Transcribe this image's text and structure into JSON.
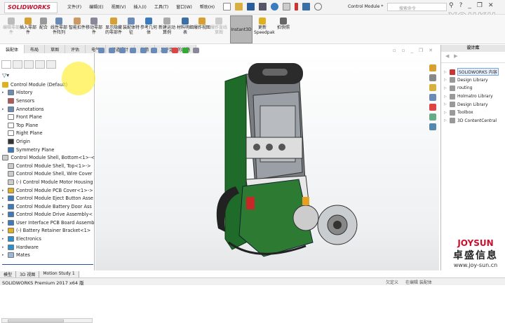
{
  "title": {
    "logo": "SOLIDWORKS",
    "menus": [
      "文件(F)",
      "编辑(E)",
      "视图(V)",
      "插入(I)",
      "工具(T)",
      "窗口(W)",
      "帮助(H)"
    ],
    "doc": "Control Module *",
    "search_placeholder": "搜索命令"
  },
  "ribbon": [
    {
      "label": "编辑零部件",
      "dis": true
    },
    {
      "label": "插入零部件"
    },
    {
      "label": "配合"
    },
    {
      "label": "线性零部件阵列"
    },
    {
      "label": "智能扣件"
    },
    {
      "label": "移动零部件"
    },
    {
      "label": "显示隐藏的零部件"
    },
    {
      "label": "装配体特征"
    },
    {
      "label": "参考几何体"
    },
    {
      "label": "新建运动算例"
    },
    {
      "label": "材料明细表"
    },
    {
      "label": "爆炸视图"
    },
    {
      "label": "爆炸直线草图",
      "dis": true
    },
    {
      "label": "Instant3D"
    },
    {
      "label": "更新Speedpak"
    },
    {
      "label": "拍快照"
    }
  ],
  "cmd_tabs": [
    "装配体",
    "布局",
    "草图",
    "评估",
    "电气",
    "管道设计",
    "管筒",
    "用户定义的线路"
  ],
  "tree": {
    "root": "Control Module  (Default)",
    "items": [
      {
        "label": "History",
        "exp": true,
        "c": "#6a8ab8"
      },
      {
        "label": "Sensors",
        "c": "#b55"
      },
      {
        "label": "Annotations",
        "exp": true,
        "c": "#6a8ab8"
      },
      {
        "label": "Front Plane",
        "c": "#fff"
      },
      {
        "label": "Top Plane",
        "c": "#fff"
      },
      {
        "label": "Right Plane",
        "c": "#fff"
      },
      {
        "label": "Origin",
        "c": "#333"
      },
      {
        "label": "Symmetry Plane",
        "c": "#3a7bbf"
      },
      {
        "label": "Control Module Shell, Bottom<1>-<",
        "c": "#ccc"
      },
      {
        "label": "Control Module Shell, Top<1>->",
        "c": "#ccc"
      },
      {
        "label": "Control Module Shell, Wire Cover",
        "c": "#ccc"
      },
      {
        "label": "(-) Control Module Motor Housing",
        "c": "#ccc"
      },
      {
        "label": "Control Module PCB Cover<1>->",
        "exp": true,
        "c": "#e0b020"
      },
      {
        "label": "Control Module Eject Button Asse",
        "exp": true,
        "c": "#3a7bbf"
      },
      {
        "label": "Control Module Battery Door Ass",
        "exp": true,
        "c": "#3a7bbf"
      },
      {
        "label": "Control Module Drive Assembly<",
        "exp": true,
        "c": "#3a7bbf"
      },
      {
        "label": "User Interface PCB Board Assemb",
        "exp": true,
        "c": "#3a7bbf"
      },
      {
        "label": "(-) Battery Retainer Bracket<1>",
        "exp": true,
        "c": "#e0b020"
      },
      {
        "label": "Electronics",
        "exp": true,
        "c": "#2b8fd0"
      },
      {
        "label": "Hardware",
        "exp": true,
        "c": "#2b8fd0"
      },
      {
        "label": "Mates",
        "exp": true,
        "c": "#9bb8d8"
      }
    ]
  },
  "model_tabs": [
    "模型",
    "3D 视图",
    "Motion Study 1"
  ],
  "status": {
    "left": "SOLIDWORKS Premium 2017 x64 版",
    "right": [
      "欠定义",
      "在编辑 装配体"
    ]
  },
  "design_library": {
    "title": "设计库",
    "items": [
      {
        "label": "SOLIDWORKS 内容",
        "sel": true
      },
      {
        "label": "Design Library"
      },
      {
        "label": "routing"
      },
      {
        "label": "Holmatro Library"
      },
      {
        "label": "Design Library"
      },
      {
        "label": "Toolbox"
      },
      {
        "label": "3D ContentCentral"
      }
    ]
  },
  "watermark": {
    "youku": "YOUKU",
    "brand": "JOYSUN",
    "brand_cn": "卓盛信息",
    "url": "www.joy-sun.cn"
  }
}
